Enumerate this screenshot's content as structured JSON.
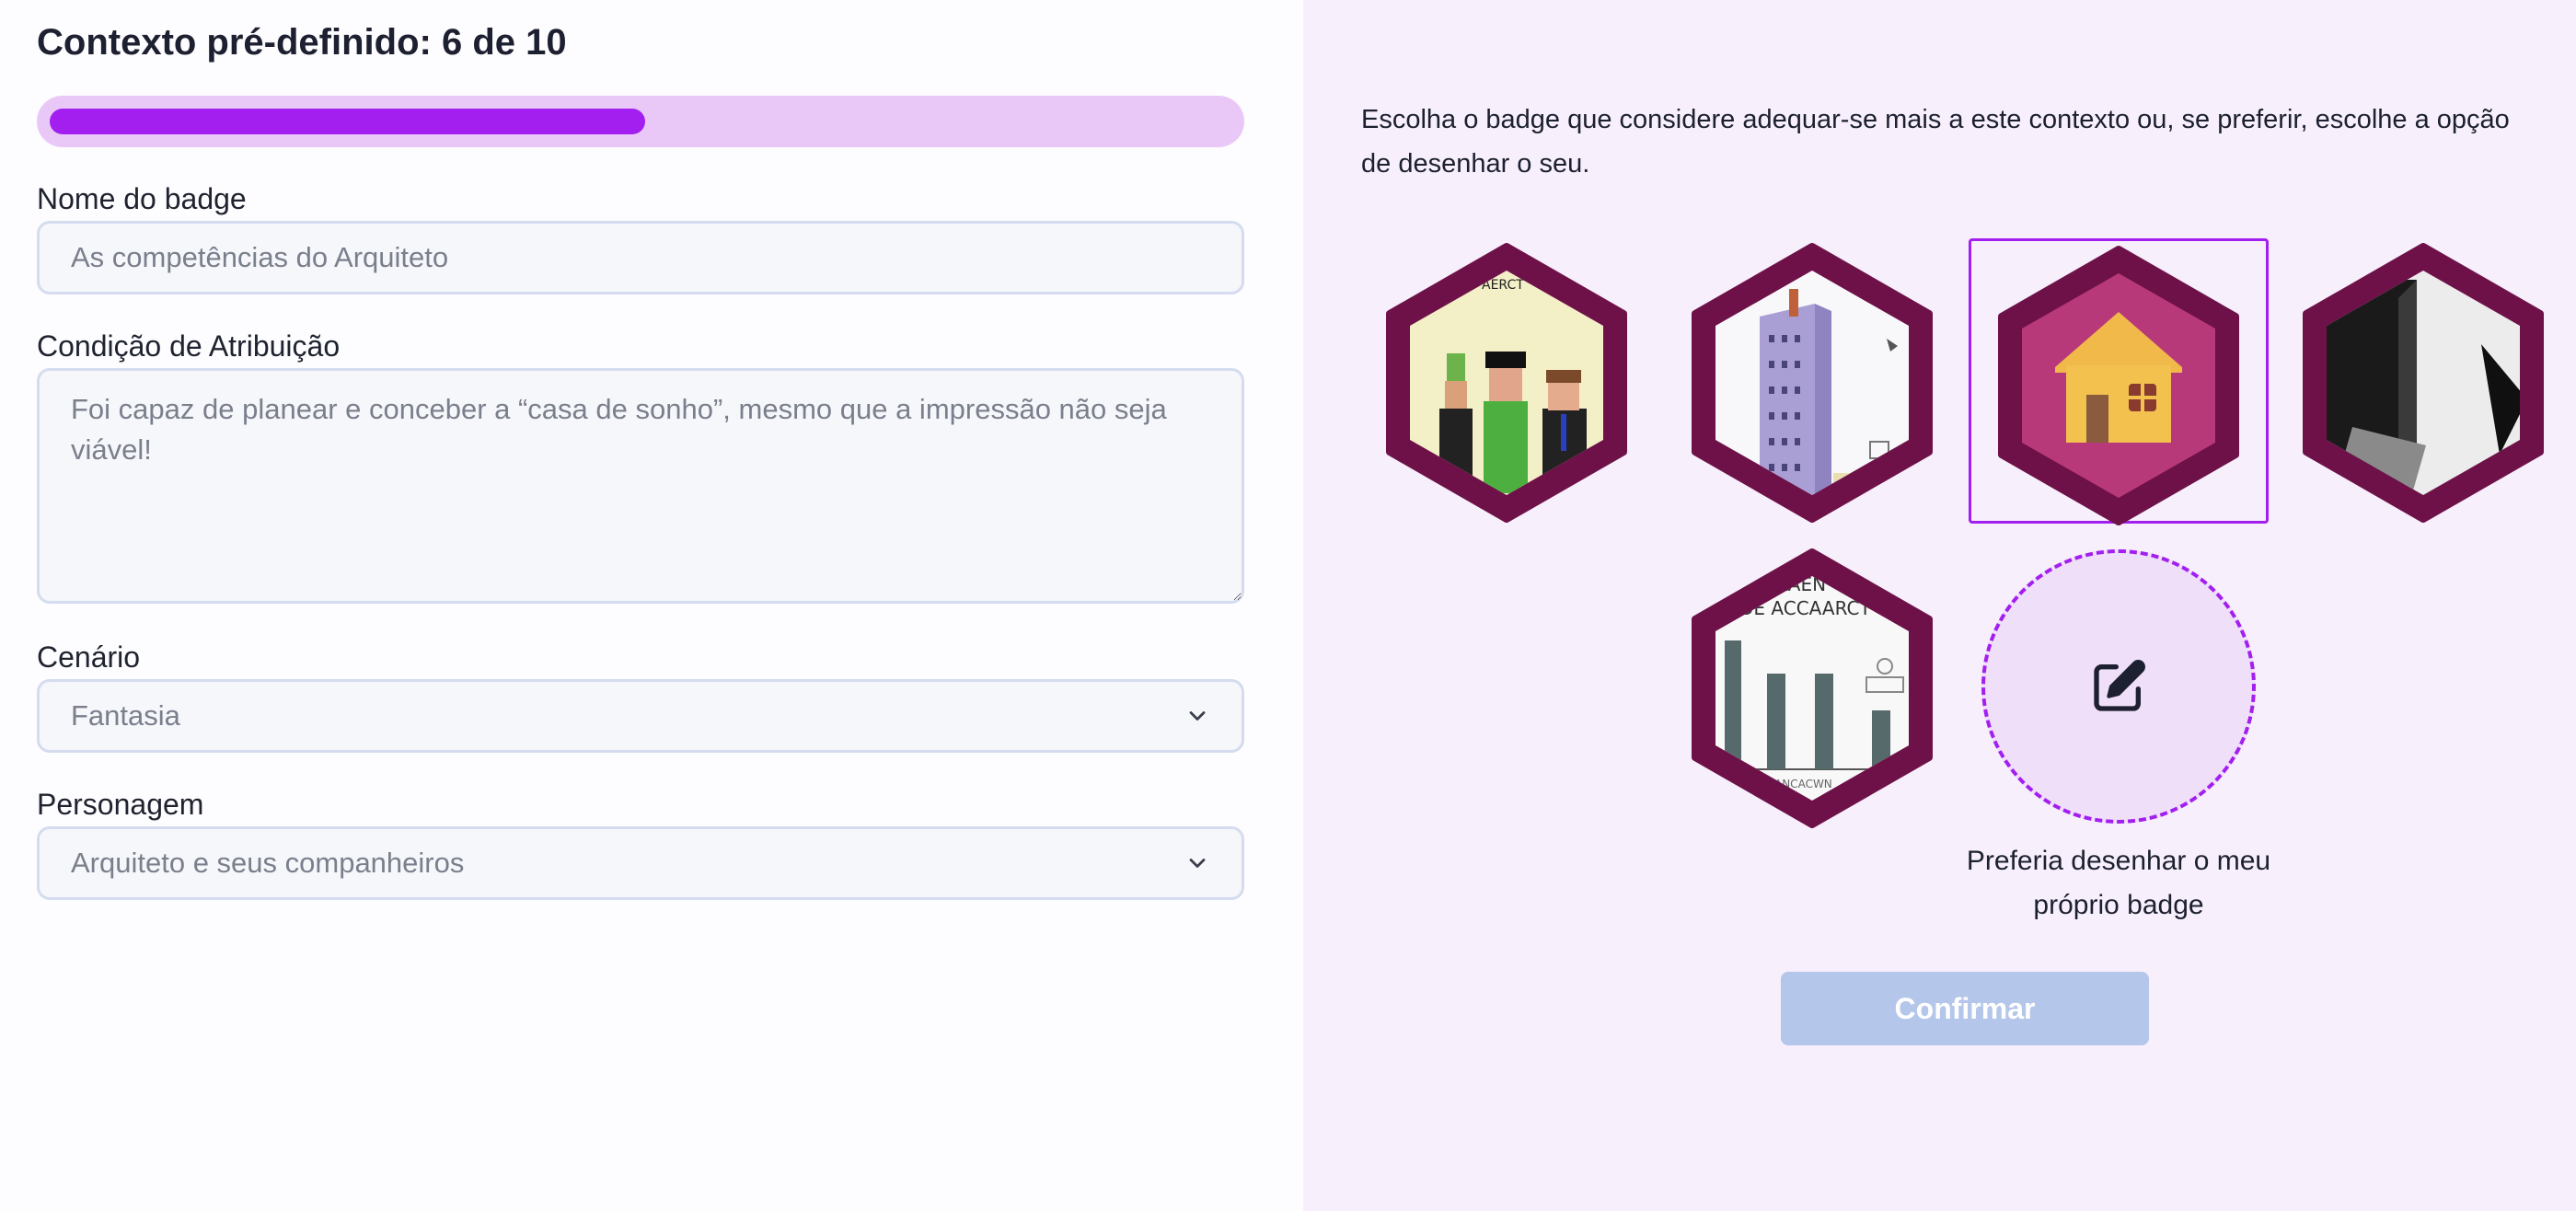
{
  "header": {
    "title": "Contexto pré-definido: 6 de 10",
    "progress_fraction": 0.6
  },
  "form": {
    "badge_name_label": "Nome do badge",
    "badge_name_placeholder": "As competências do Arquiteto",
    "condition_label": "Condição de Atribuição",
    "condition_placeholder": "Foi capaz de planear e conceber a “casa de sonho”, mesmo que a impressão não seja viável!",
    "scenario_label": "Cenário",
    "scenario_value": "Fantasia",
    "character_label": "Personagem",
    "character_value": "Arquiteto e seus companheiros"
  },
  "badges": {
    "instruction": "Escolha o badge que considere adequar-se mais a este contexto ou, se preferir, escolhe a opção de desenhar o seu.",
    "items": [
      {
        "name": "badge-people",
        "selected": false
      },
      {
        "name": "badge-building",
        "selected": false
      },
      {
        "name": "badge-house",
        "selected": true
      },
      {
        "name": "badge-abstract",
        "selected": false
      },
      {
        "name": "badge-chart",
        "selected": false
      }
    ],
    "draw_own_label": "Preferia desenhar o meu próprio badge",
    "confirm_label": "Confirmar"
  },
  "colors": {
    "accent": "#a21fef",
    "badge_border": "#6e1148",
    "house_bg": "#b8397a",
    "progress_track": "#e9c8f7",
    "confirm_disabled": "#b4c6ea",
    "right_panel_bg": "#f7f0fc"
  }
}
